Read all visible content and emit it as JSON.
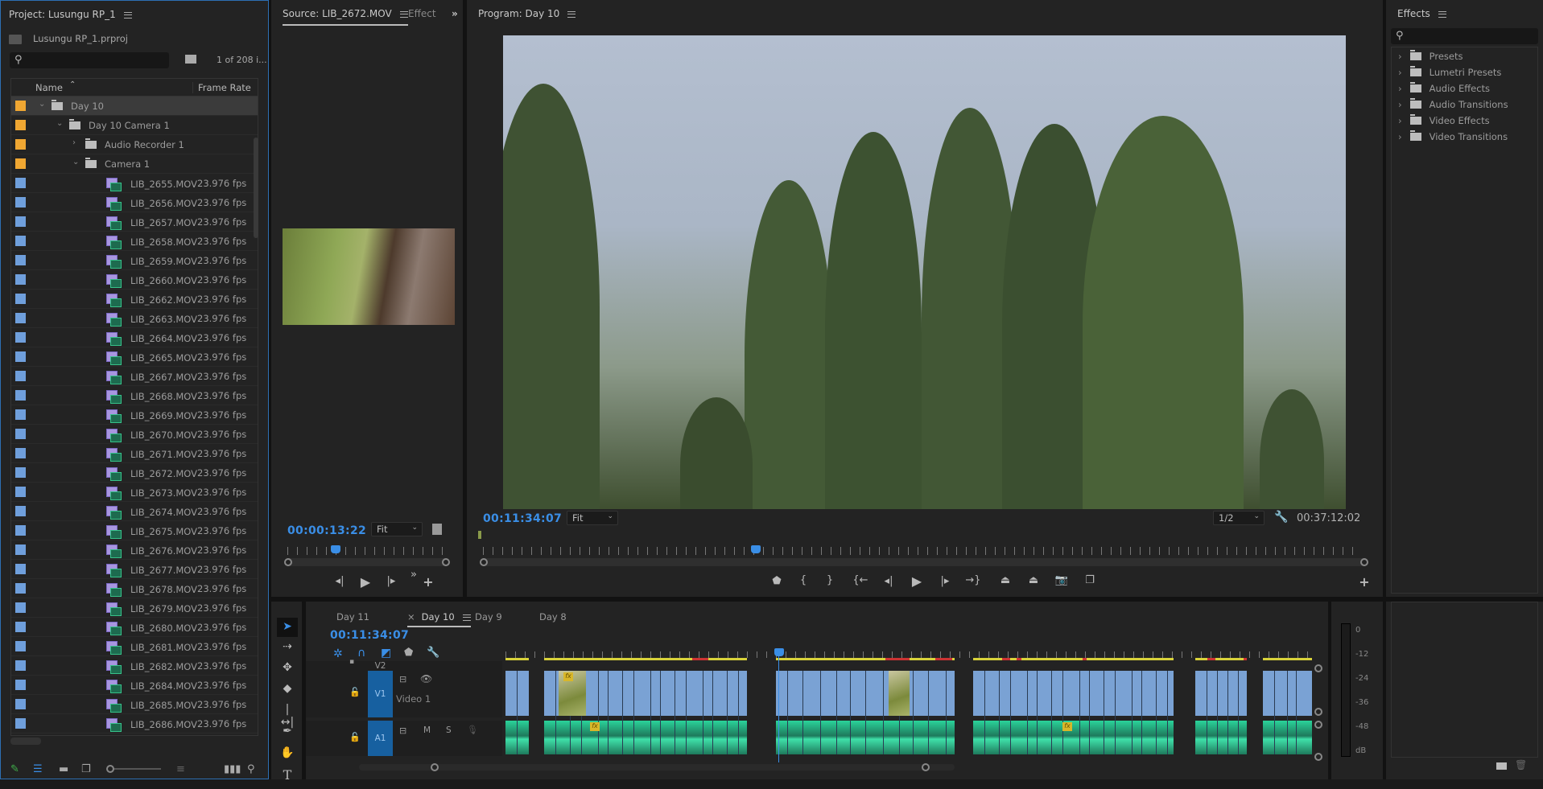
{
  "project": {
    "title": "Project: Lusungu RP_1",
    "file": "Lusungu RP_1.prproj",
    "search_placeholder": "",
    "count": "1 of 208 i...",
    "columns": {
      "name": "Name",
      "frame_rate": "Frame Rate"
    },
    "folders": [
      {
        "label": "Day 10",
        "color": "#f0a732"
      },
      {
        "label": "Day 10 Camera 1",
        "color": "#f0a732"
      },
      {
        "label": "Audio Recorder 1",
        "color": "#f0a732"
      },
      {
        "label": "Camera 1",
        "color": "#f0a732"
      }
    ],
    "clips": [
      {
        "name": "LIB_2655.MOV",
        "fps": "23.976 fps"
      },
      {
        "name": "LIB_2656.MOV",
        "fps": "23.976 fps"
      },
      {
        "name": "LIB_2657.MOV",
        "fps": "23.976 fps"
      },
      {
        "name": "LIB_2658.MOV",
        "fps": "23.976 fps"
      },
      {
        "name": "LIB_2659.MOV",
        "fps": "23.976 fps"
      },
      {
        "name": "LIB_2660.MOV",
        "fps": "23.976 fps"
      },
      {
        "name": "LIB_2662.MOV",
        "fps": "23.976 fps"
      },
      {
        "name": "LIB_2663.MOV",
        "fps": "23.976 fps"
      },
      {
        "name": "LIB_2664.MOV",
        "fps": "23.976 fps"
      },
      {
        "name": "LIB_2665.MOV",
        "fps": "23.976 fps"
      },
      {
        "name": "LIB_2667.MOV",
        "fps": "23.976 fps"
      },
      {
        "name": "LIB_2668.MOV",
        "fps": "23.976 fps"
      },
      {
        "name": "LIB_2669.MOV",
        "fps": "23.976 fps"
      },
      {
        "name": "LIB_2670.MOV",
        "fps": "23.976 fps"
      },
      {
        "name": "LIB_2671.MOV",
        "fps": "23.976 fps"
      },
      {
        "name": "LIB_2672.MOV",
        "fps": "23.976 fps"
      },
      {
        "name": "LIB_2673.MOV",
        "fps": "23.976 fps"
      },
      {
        "name": "LIB_2674.MOV",
        "fps": "23.976 fps"
      },
      {
        "name": "LIB_2675.MOV",
        "fps": "23.976 fps"
      },
      {
        "name": "LIB_2676.MOV",
        "fps": "23.976 fps"
      },
      {
        "name": "LIB_2677.MOV",
        "fps": "23.976 fps"
      },
      {
        "name": "LIB_2678.MOV",
        "fps": "23.976 fps"
      },
      {
        "name": "LIB_2679.MOV",
        "fps": "23.976 fps"
      },
      {
        "name": "LIB_2680.MOV",
        "fps": "23.976 fps"
      },
      {
        "name": "LIB_2681.MOV",
        "fps": "23.976 fps"
      },
      {
        "name": "LIB_2682.MOV",
        "fps": "23.976 fps"
      },
      {
        "name": "LIB_2684.MOV",
        "fps": "23.976 fps"
      },
      {
        "name": "LIB_2685.MOV",
        "fps": "23.976 fps"
      },
      {
        "name": "LIB_2686.MOV",
        "fps": "23.976 fps"
      }
    ],
    "clip_color": "#6f9fdc"
  },
  "source": {
    "tab": "Source: LIB_2672.MOV",
    "tab2": "Effect",
    "overflow": "»",
    "timecode": "00:00:13:22",
    "fit": "Fit",
    "playhead_fraction": 0.3
  },
  "program": {
    "title": "Program: Day 10",
    "timecode": "00:11:34:07",
    "fit": "Fit",
    "resolution": "1/2",
    "duration": "00:37:12:02",
    "playhead_fraction": 0.31
  },
  "effects": {
    "title": "Effects",
    "items": [
      "Presets",
      "Lumetri Presets",
      "Audio Effects",
      "Audio Transitions",
      "Video Effects",
      "Video Transitions"
    ]
  },
  "timeline": {
    "tabs": [
      "Day 11",
      "Day 10",
      "Day 9",
      "Day 8"
    ],
    "active_tab": "Day 10",
    "timecode": "00:11:34:07",
    "tracks": {
      "v2": "V2",
      "v1": "V1",
      "v1_name": "Video 1",
      "a1": "A1",
      "mute": "M",
      "solo": "S"
    }
  },
  "meter": {
    "labels": [
      "0",
      "-12",
      "-24",
      "-36",
      "-48",
      "dB"
    ]
  }
}
